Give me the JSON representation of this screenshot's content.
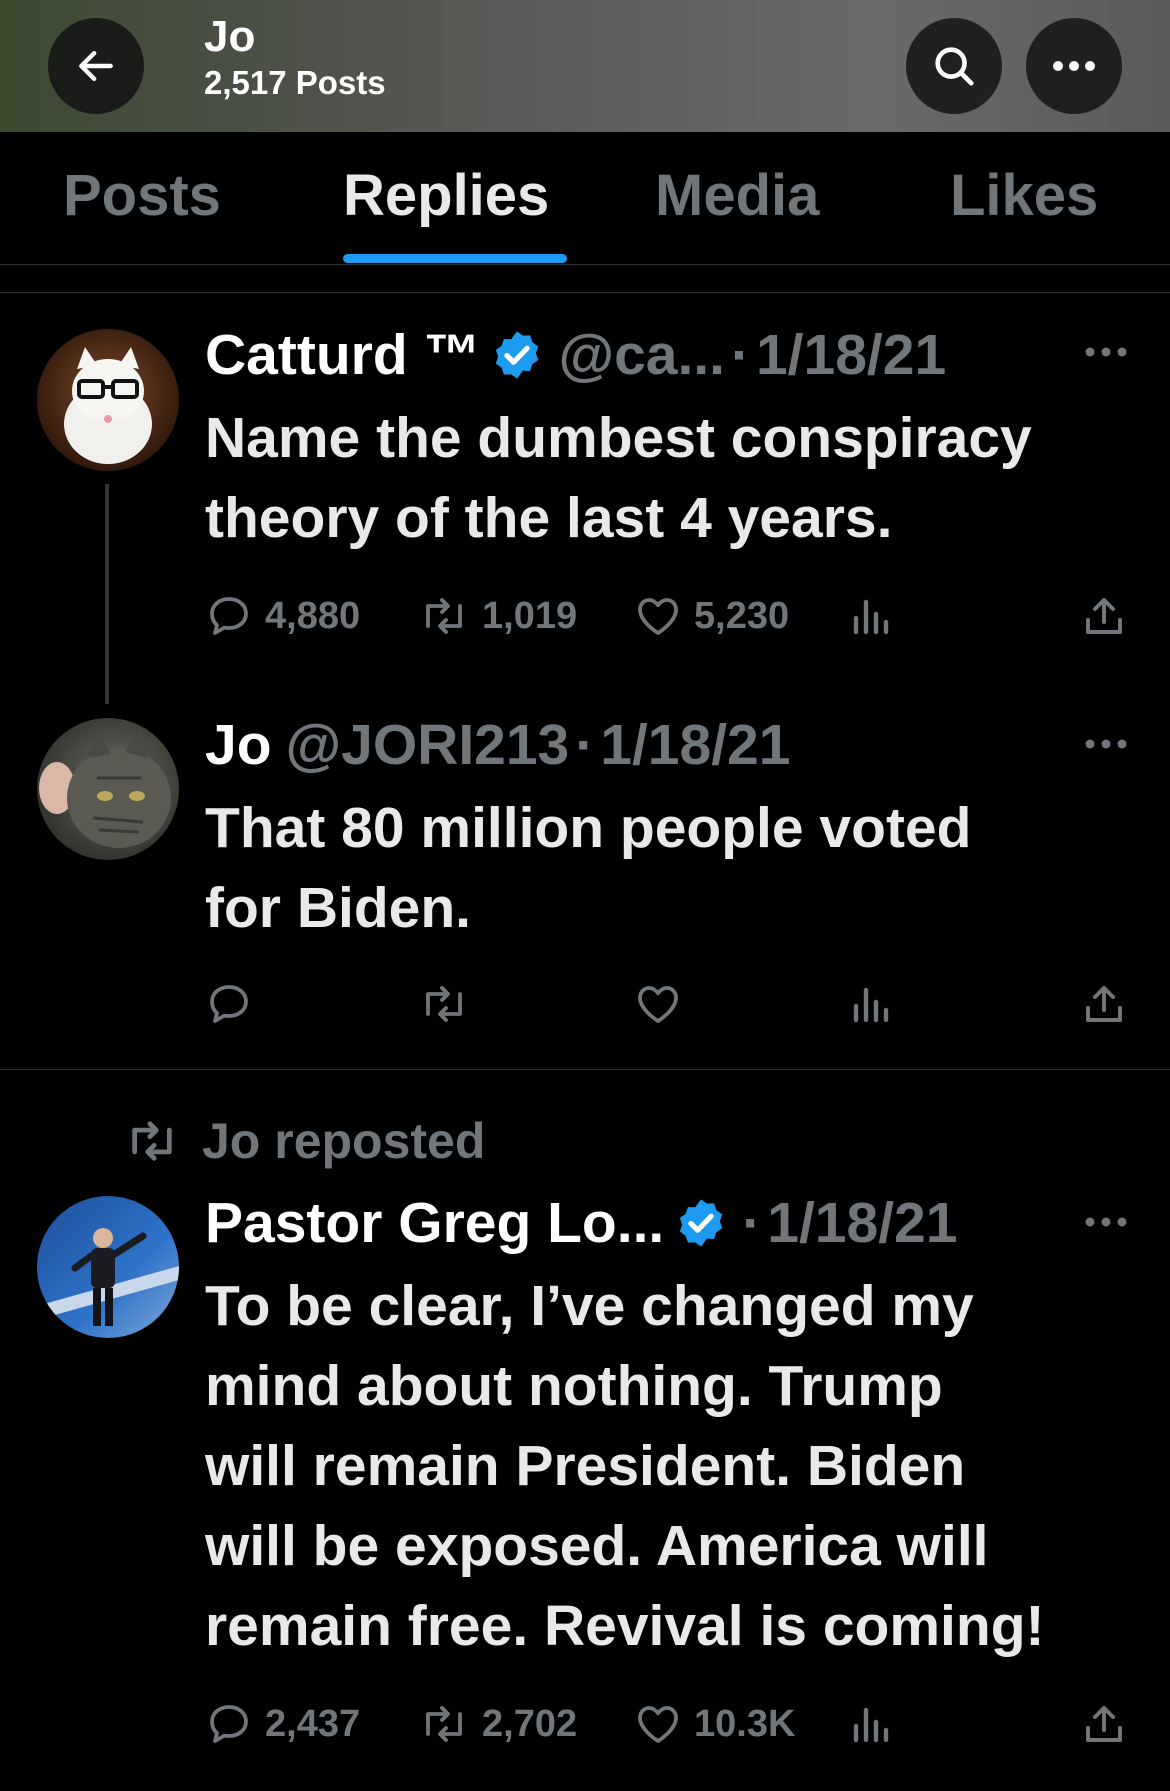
{
  "header": {
    "name": "Jo",
    "posts_count": "2,517 Posts"
  },
  "tabs": [
    "Posts",
    "Replies",
    "Media",
    "Likes"
  ],
  "active_tab": "Replies",
  "colors": {
    "accent": "#1d9bf0",
    "verified": "#1d9bf0",
    "muted_text": "#71767b",
    "background": "#000000"
  },
  "tweets": [
    {
      "display_name": "Catturd ™",
      "verified": true,
      "handle": "@ca...",
      "dot": "·",
      "date": "1/18/21",
      "text_lines": [
        "Name the dumbest conspiracy",
        "theory of the last 4 years."
      ],
      "replies": "4,880",
      "reposts": "1,019",
      "likes": "5,230",
      "avatar_icon": "cat-with-glasses-avatar"
    },
    {
      "display_name": "Jo",
      "verified": false,
      "handle": "@JORI213",
      "dot": "·",
      "date": "1/18/21",
      "text_lines": [
        "That 80 million people voted",
        "for Biden."
      ],
      "replies": "",
      "reposts": "",
      "likes": "",
      "avatar_icon": "tabby-cat-avatar"
    },
    {
      "repost_label": "Jo reposted",
      "display_name": "Pastor Greg Lo...",
      "verified": true,
      "dot": "·",
      "date": "1/18/21",
      "text_lines": [
        "To be clear, I’ve changed my",
        "mind about nothing. Trump",
        "will remain President. Biden",
        "will be exposed. America will",
        "remain free. Revival is coming!"
      ],
      "replies": "2,437",
      "reposts": "2,702",
      "likes": "10.3K",
      "avatar_icon": "stage-speaker-avatar"
    }
  ]
}
